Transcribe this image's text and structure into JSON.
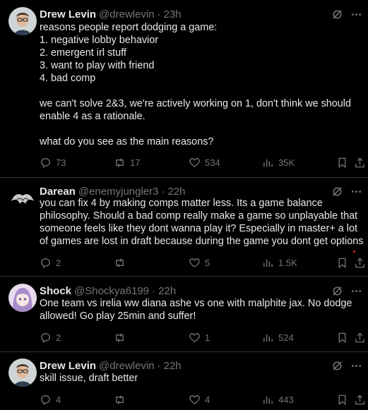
{
  "colors": {
    "background": "#000000",
    "text": "#e7e9ea",
    "muted": "#71767b",
    "divider": "#2f3336"
  },
  "tweets": [
    {
      "name": "Drew Levin",
      "handle": "@drewlevin",
      "sep": "·",
      "time": "23h",
      "text": "reasons people report dodging a game:\n1. negative lobby behavior\n2. emergent irl stuff\n3. want to play with friend\n4. bad comp\n\nwe can't solve 2&3, we're actively working on 1, don't think we should enable 4 as a rationale.\n\nwhat do you see as the main reasons?",
      "replies": "73",
      "reposts": "17",
      "likes": "534",
      "views": "35K",
      "avatar": "person-glasses-icon"
    },
    {
      "name": "Darean",
      "handle": "@enemyjungler3",
      "sep": "·",
      "time": "22h",
      "text": "you can fix 4 by making comps matter less. Its a game balance philosophy. Should a bad comp really make a game so unplayable that someone feels like they dont wanna play it? Especially in master+ a lot of games are lost in draft because during the game you dont get options",
      "replies": "2",
      "reposts": "",
      "likes": "5",
      "views": "1.5K",
      "avatar": "dark-creature-icon"
    },
    {
      "name": "Shock",
      "handle": "@Shockya6199",
      "sep": "·",
      "time": "22h",
      "text": "One team vs irelia ww diana ashe vs one with malphite jax. No dodge allowed! Go play 25min and suffer!",
      "replies": "2",
      "reposts": "",
      "likes": "1",
      "views": "524",
      "avatar": "anime-girl-icon"
    },
    {
      "name": "Drew Levin",
      "handle": "@drewlevin",
      "sep": "·",
      "time": "22h",
      "text": "skill issue, draft better",
      "replies": "4",
      "reposts": "",
      "likes": "4",
      "views": "443",
      "avatar": "person-glasses-icon"
    }
  ]
}
